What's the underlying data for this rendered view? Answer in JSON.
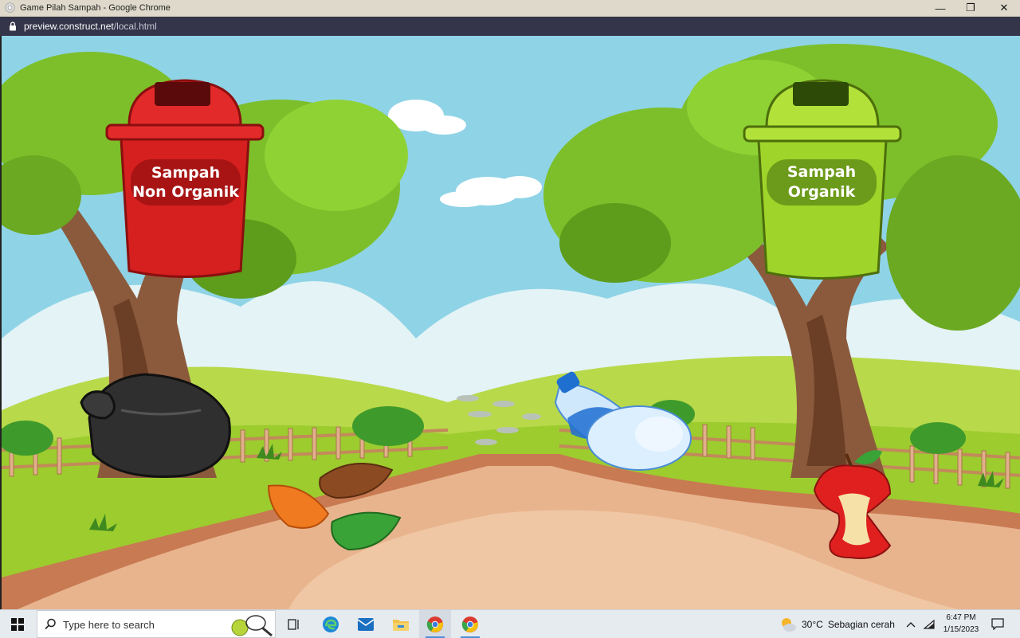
{
  "window": {
    "title": "Game Pilah Sampah - Google Chrome",
    "minimize": "—",
    "restore": "❐",
    "close": "✕"
  },
  "address": {
    "host": "preview.construct.net",
    "path": "/local.html"
  },
  "game": {
    "bins": [
      {
        "label_line1": "Sampah",
        "label_line2": "Non Organik",
        "color": "#d61f1f"
      },
      {
        "label_line1": "Sampah",
        "label_line2": "Organik",
        "color": "#9fd42a"
      }
    ],
    "items": [
      "black-garbage-bag",
      "plastic-bottles",
      "dry-leaves",
      "apple-core"
    ]
  },
  "taskbar": {
    "search_placeholder": "Type here to search",
    "weather_temp": "30°C",
    "weather_desc": "Sebagian cerah",
    "time": "6:47 PM",
    "date": "1/15/2023"
  },
  "colors": {
    "sky": "#8fd3e6",
    "grass": "#9ccc2e",
    "path": "#e8b48e",
    "titlebar": "#ded9cb",
    "urlbar": "#34344a"
  }
}
